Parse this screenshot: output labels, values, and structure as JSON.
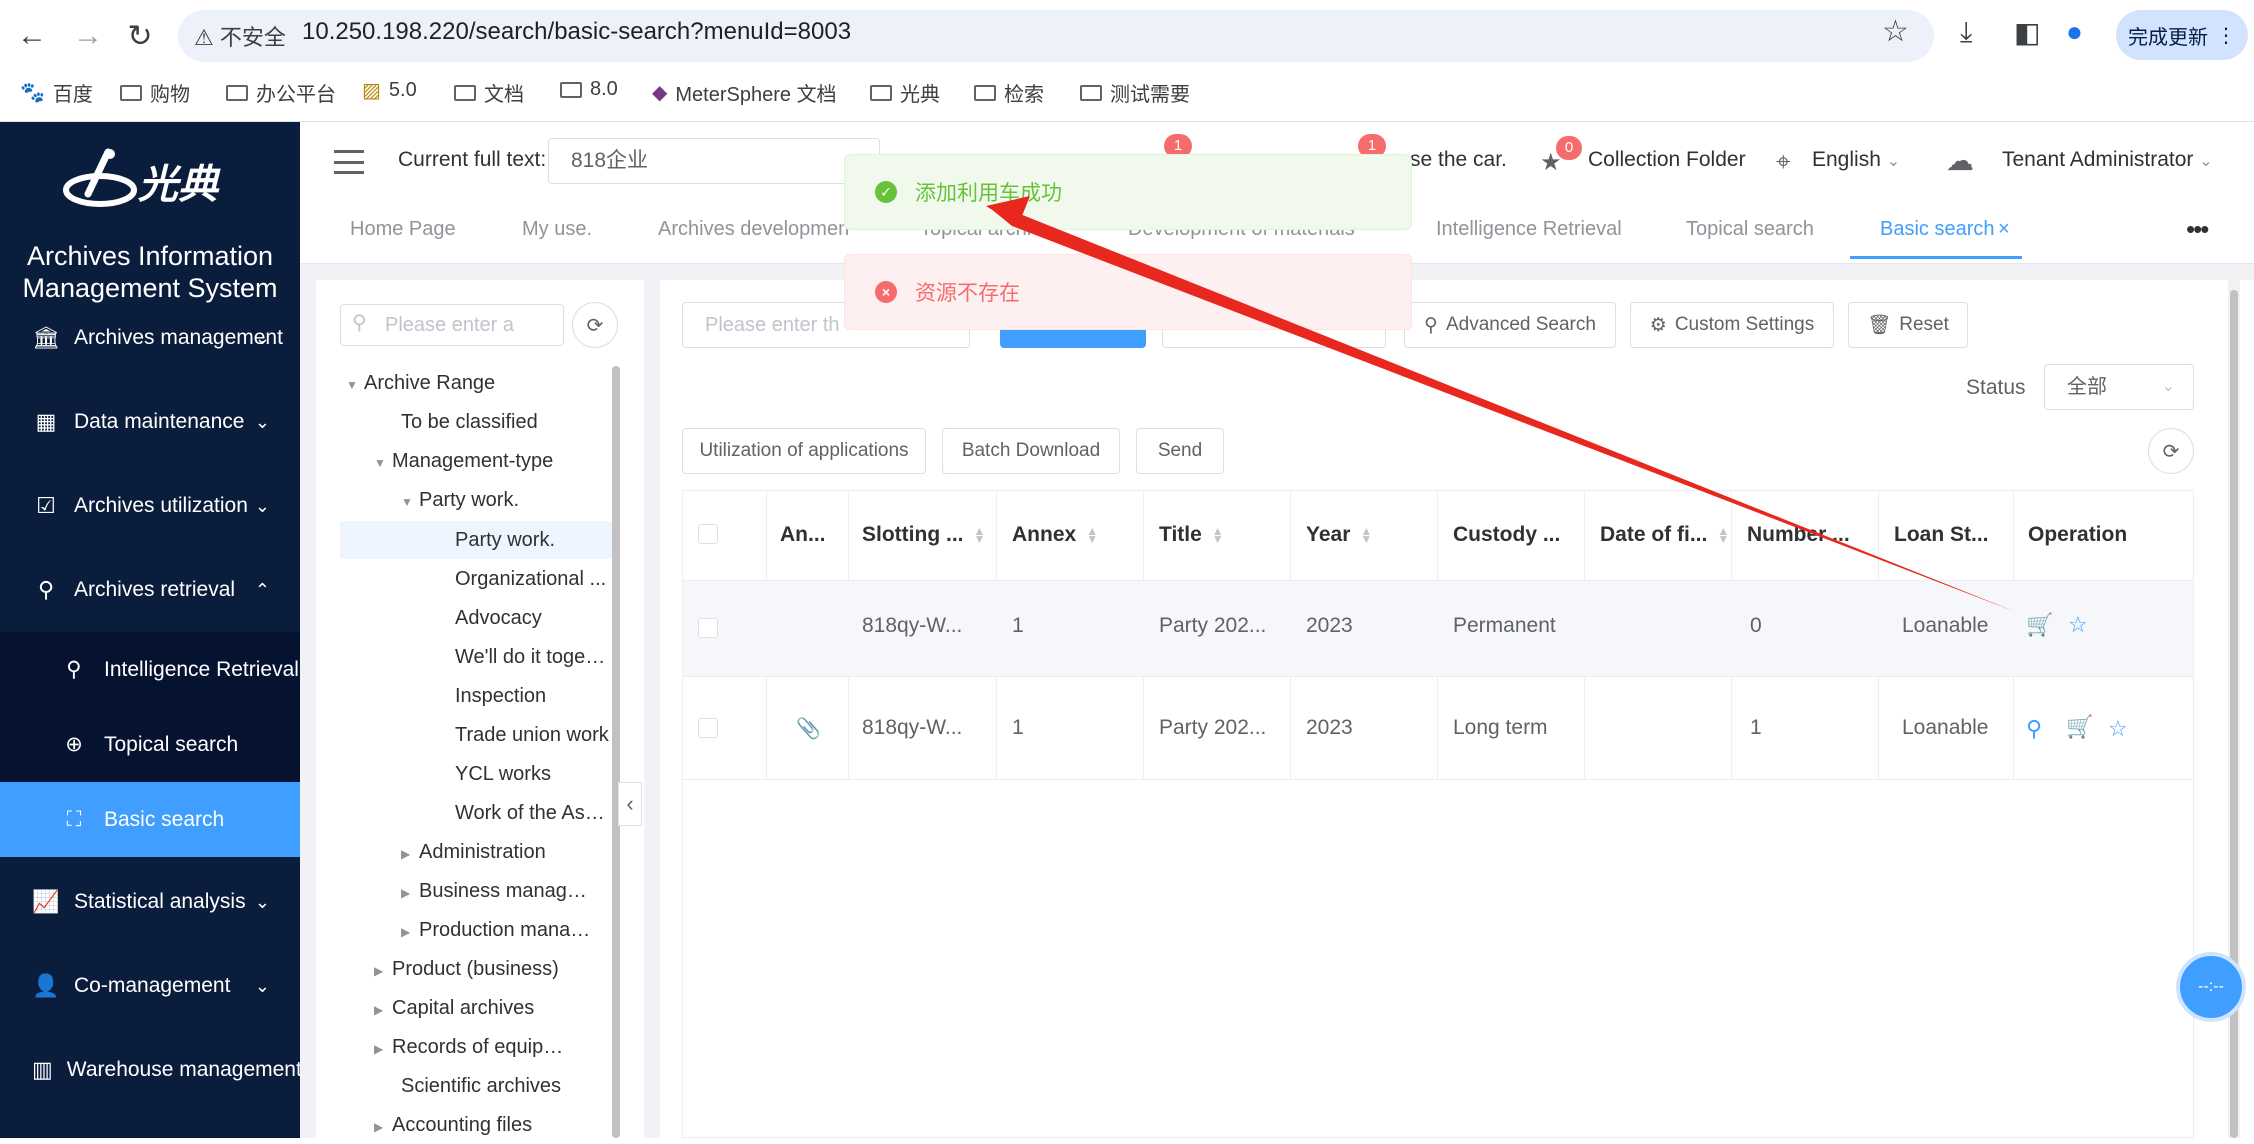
{
  "browser": {
    "security": "不安全",
    "url": "10.250.198.220/search/basic-search?menuId=8003",
    "update_button": "完成更新",
    "bookmarks": [
      "百度",
      "购物",
      "办公平台",
      "5.0",
      "文档",
      "8.0",
      "MeterSphere 文档",
      "光典",
      "检索",
      "测试需要"
    ]
  },
  "sidebar": {
    "logo_text": "光典",
    "system_title_line1": "Archives Information",
    "system_title_line2": "Management System",
    "items": [
      {
        "label": "Archives management"
      },
      {
        "label": "Data maintenance"
      },
      {
        "label": "Archives utilization"
      },
      {
        "label": "Archives retrieval"
      },
      {
        "label": "Statistical analysis"
      },
      {
        "label": "Co-management"
      },
      {
        "label": "Warehouse management"
      }
    ],
    "subitems": [
      {
        "label": "Intelligence Retrieval"
      },
      {
        "label": "Topical search"
      },
      {
        "label": "Basic search"
      }
    ]
  },
  "header": {
    "fulltext_label": "Current full text:",
    "fulltext_value": "818企业",
    "badge_1": "1",
    "badge_2": "1",
    "car_text": "se the car.",
    "collection_badge": "0",
    "collection_label": "Collection Folder",
    "language": "English",
    "user": "Tenant Administrator"
  },
  "tabs": [
    "Home Page",
    "My use.",
    "Archives development",
    "Topical archive",
    "Development of materials",
    "Intelligence Retrieval",
    "Topical search",
    "Basic search"
  ],
  "tree": {
    "search_placeholder": "Please enter a",
    "nodes": [
      "Archive Range",
      "To be classified",
      "Management-type",
      "Party work.",
      "Party work.",
      "Organizational ...",
      "Advocacy",
      "We'll do it together",
      "Inspection",
      "Trade union work",
      "YCL works",
      "Work of the Association",
      "Administration",
      "Business management",
      "Production management",
      "Product (business)",
      "Capital archives",
      "Records of equipment",
      "Scientific archives",
      "Accounting files"
    ]
  },
  "toolbar": {
    "search_placeholder": "Please enter th",
    "advanced_search": "Advanced Search",
    "custom_settings": "Custom Settings",
    "reset": "Reset",
    "status_label": "Status",
    "status_value": "全部",
    "utilization_button": "Utilization of applications",
    "batch_download": "Batch Download",
    "send": "Send"
  },
  "table": {
    "headers": [
      "An...",
      "Slotting ...",
      "Annex",
      "Title",
      "Year",
      "Custody ...",
      "Date of fi...",
      "Number ...",
      "Loan St...",
      "Operation"
    ],
    "rows": [
      {
        "slotting": "818qy-W...",
        "annex": "1",
        "title": "Party 202...",
        "year": "2023",
        "custody": "Permanent",
        "date": "",
        "number": "0",
        "loan": "Loanable"
      },
      {
        "slotting": "818qy-W...",
        "annex": "1",
        "title": "Party 202...",
        "year": "2023",
        "custody": "Long term",
        "date": "",
        "number": "1",
        "loan": "Loanable"
      }
    ]
  },
  "toasts": {
    "success": "添加利用车成功",
    "error": "资源不存在"
  },
  "float_ball": "--:--",
  "colors": {
    "primary": "#409eff",
    "sidebar": "#0b1d3c",
    "success": "#67c23a",
    "error": "#f56c6c",
    "annotation": "#e8281e"
  }
}
